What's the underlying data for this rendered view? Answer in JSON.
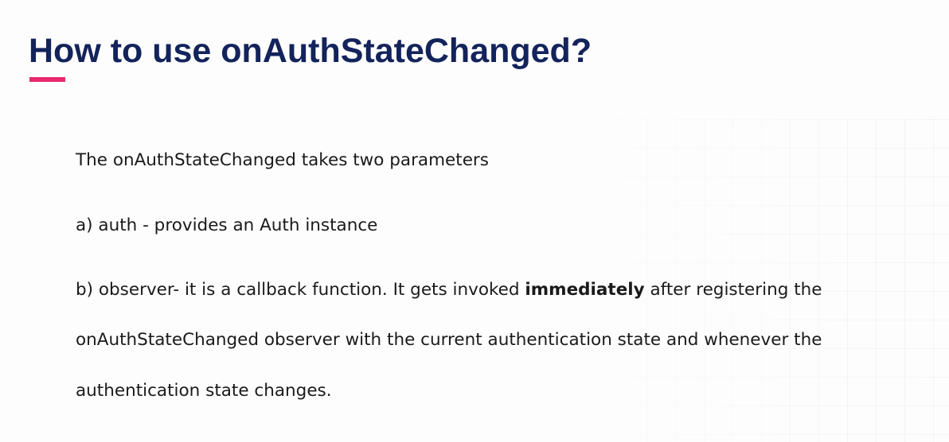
{
  "title": "How to use onAuthStateChanged?",
  "colors": {
    "title": "#13235b",
    "accent": "#e8296f",
    "text": "#1a1a1a"
  },
  "body": {
    "intro": "The onAuthStateChanged takes two parameters",
    "param_a": "a) auth - provides an Auth instance",
    "param_b_line1_prefix": "b) observer-  it is a callback function. It gets  invoked ",
    "param_b_line1_bold": "immediately",
    "param_b_line1_suffix": " after registering the",
    "param_b_line2": "onAuthStateChanged observer with the current authentication state and whenever the",
    "param_b_line3": "authentication state changes."
  }
}
